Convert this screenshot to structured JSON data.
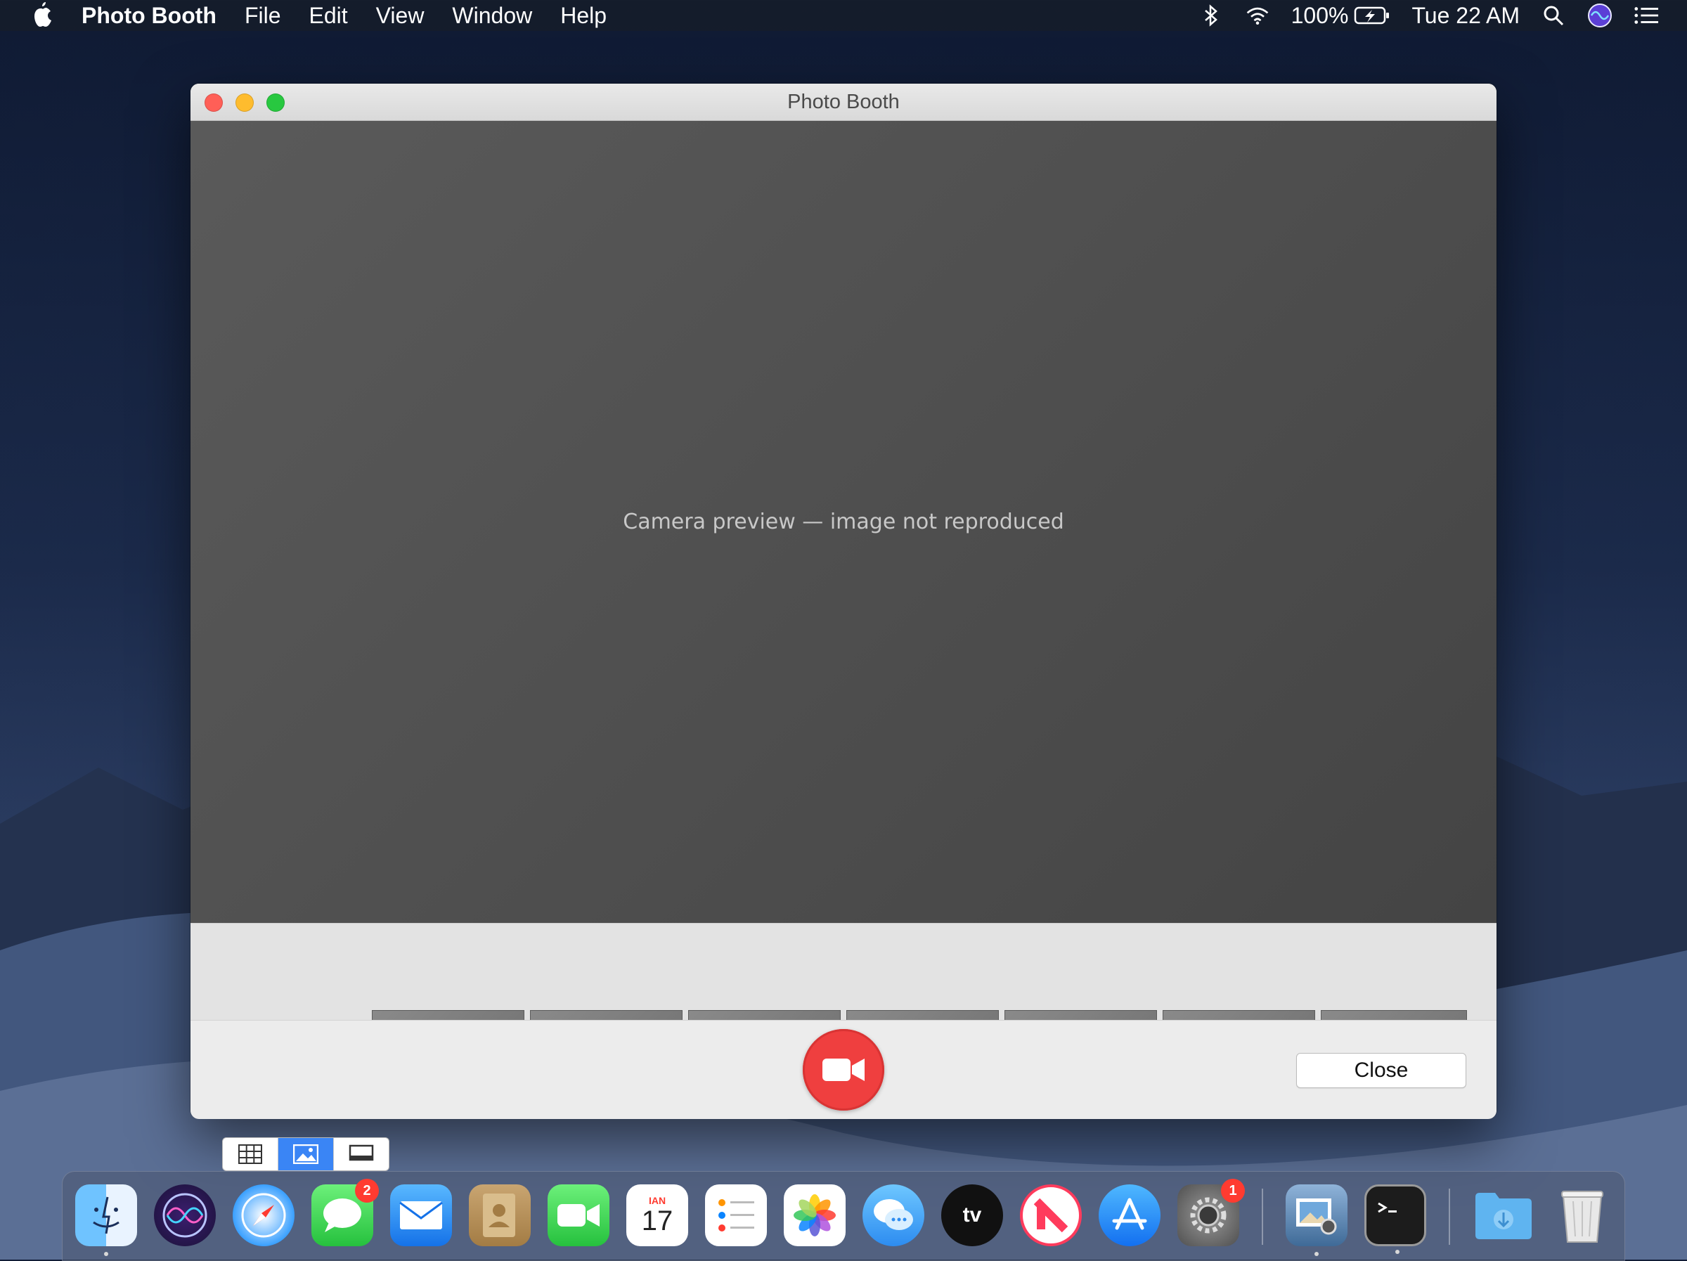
{
  "menubar": {
    "app_name": "Photo Booth",
    "menus": [
      "File",
      "Edit",
      "View",
      "Window",
      "Help"
    ],
    "battery": "100%",
    "clock": "Tue 22 AM"
  },
  "window": {
    "title": "Photo Booth",
    "preview_note": "Camera preview — image not reproduced",
    "thumbnail_count": 7,
    "view_modes": [
      "grid-view",
      "single-photo-view",
      "filmstrip-view"
    ],
    "active_view_mode": "single-photo-view",
    "close_label": "Close"
  },
  "dock": {
    "items": [
      {
        "name": "finder",
        "badge": ""
      },
      {
        "name": "siri",
        "badge": ""
      },
      {
        "name": "safari",
        "badge": ""
      },
      {
        "name": "messages",
        "badge": "2"
      },
      {
        "name": "mail",
        "badge": ""
      },
      {
        "name": "contacts",
        "badge": ""
      },
      {
        "name": "facetime",
        "badge": ""
      },
      {
        "name": "calendar",
        "badge": ""
      },
      {
        "name": "reminders",
        "badge": ""
      },
      {
        "name": "photos",
        "badge": ""
      },
      {
        "name": "messages-alt",
        "badge": ""
      },
      {
        "name": "apple-tv",
        "badge": ""
      },
      {
        "name": "news",
        "badge": ""
      },
      {
        "name": "app-store",
        "badge": ""
      },
      {
        "name": "system-preferences",
        "badge": "1"
      },
      {
        "name": "preview",
        "badge": ""
      },
      {
        "name": "terminal",
        "badge": ""
      },
      {
        "name": "downloads-folder",
        "badge": ""
      },
      {
        "name": "trash",
        "badge": ""
      }
    ],
    "calendar_month": "ΙΑΝ",
    "calendar_day": "17",
    "tv_label": "tv"
  },
  "colors": {
    "accent": "#3a85f5",
    "record": "#ef3f3f",
    "badge": "#ff3b30"
  }
}
